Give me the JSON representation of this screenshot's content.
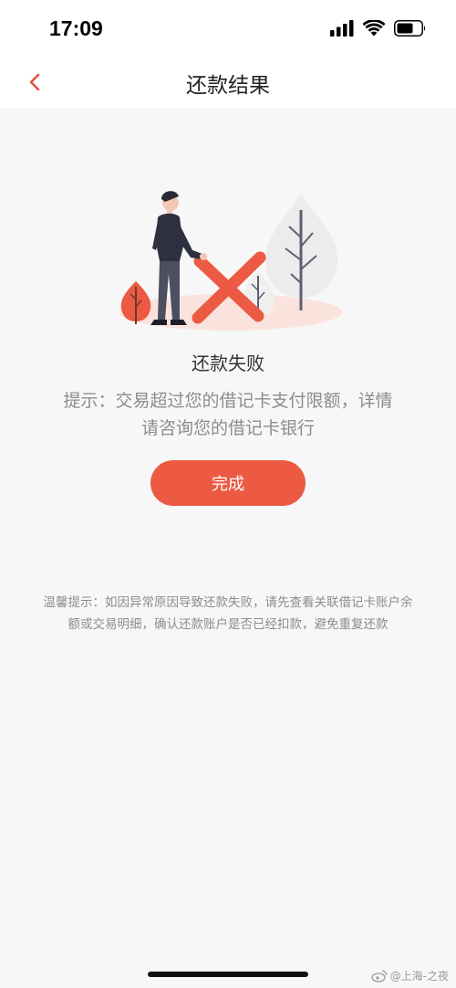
{
  "status_bar": {
    "time": "17:09",
    "icons": [
      "cellular-signal-icon",
      "wifi-icon",
      "battery-icon"
    ]
  },
  "nav": {
    "back_icon": "chevron-left-icon",
    "title": "还款结果"
  },
  "result": {
    "illustration": "failure-illustration",
    "title": "还款失败",
    "hint_line1": "提示：交易超过您的借记卡支付限额，详情",
    "hint_line2": "请咨询您的借记卡银行",
    "done_label": "完成"
  },
  "warm_tip": {
    "line1": "温馨提示：如因异常原因导致还款失败，请先查看关联借记卡账户余",
    "line2": "额或交易明细，确认还款账户是否已经扣款，避免重复还款"
  },
  "watermark": {
    "text": "@上海-之夜"
  },
  "colors": {
    "accent": "#ec5a43",
    "background": "#f7f7f7",
    "muted_text": "#8c8c8c"
  }
}
